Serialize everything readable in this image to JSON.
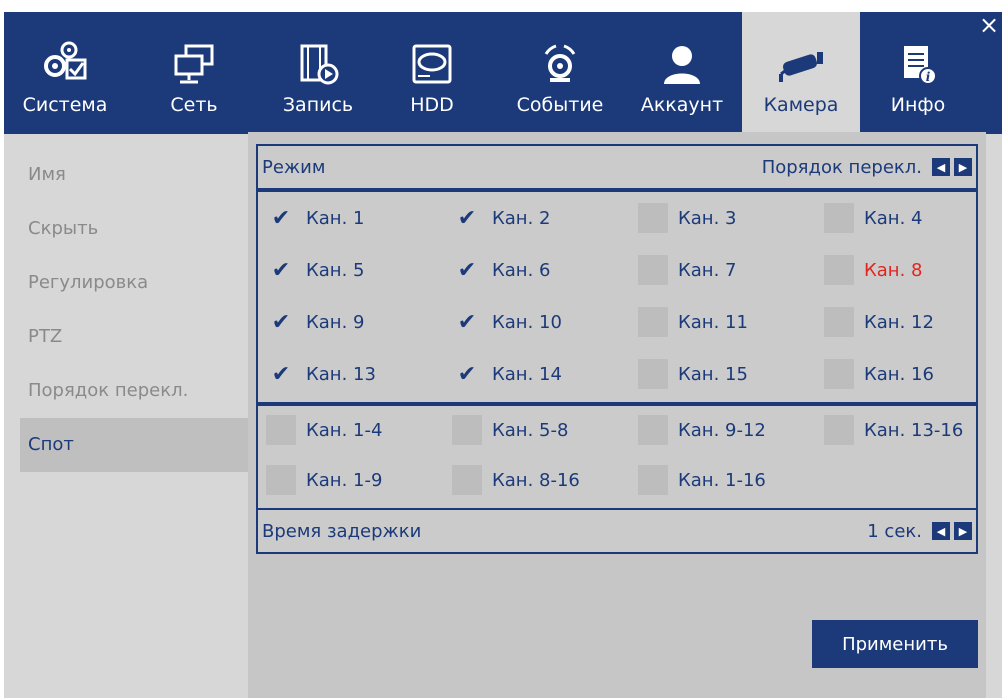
{
  "tabs": [
    {
      "label": "Система",
      "icon": "gears-icon",
      "active": false
    },
    {
      "label": "Сеть",
      "icon": "network-icon",
      "active": false
    },
    {
      "label": "Запись",
      "icon": "film-record-icon",
      "active": false
    },
    {
      "label": "HDD",
      "icon": "hdd-icon",
      "active": false
    },
    {
      "label": "Событие",
      "icon": "alarm-icon",
      "active": false
    },
    {
      "label": "Аккаунт",
      "icon": "user-icon",
      "active": false
    },
    {
      "label": "Камера",
      "icon": "camera-icon",
      "active": true
    },
    {
      "label": "Инфо",
      "icon": "info-icon",
      "active": false
    }
  ],
  "sidebar": {
    "items": [
      {
        "label": "Имя",
        "active": false
      },
      {
        "label": "Скрыть",
        "active": false
      },
      {
        "label": "Регулировка",
        "active": false
      },
      {
        "label": "PTZ",
        "active": false
      },
      {
        "label": "Порядок перекл.",
        "active": false
      },
      {
        "label": "Спот",
        "active": true
      }
    ]
  },
  "mode": {
    "label": "Режим",
    "switch_label": "Порядок перекл."
  },
  "channels": [
    {
      "label": "Кан. 1",
      "checked": true,
      "red": false
    },
    {
      "label": "Кан. 2",
      "checked": true,
      "red": false
    },
    {
      "label": "Кан. 3",
      "checked": false,
      "red": false
    },
    {
      "label": "Кан. 4",
      "checked": false,
      "red": false
    },
    {
      "label": "Кан. 5",
      "checked": true,
      "red": false
    },
    {
      "label": "Кан. 6",
      "checked": true,
      "red": false
    },
    {
      "label": "Кан. 7",
      "checked": false,
      "red": false
    },
    {
      "label": "Кан. 8",
      "checked": false,
      "red": true
    },
    {
      "label": "Кан. 9",
      "checked": true,
      "red": false
    },
    {
      "label": "Кан. 10",
      "checked": true,
      "red": false
    },
    {
      "label": "Кан. 11",
      "checked": false,
      "red": false
    },
    {
      "label": "Кан. 12",
      "checked": false,
      "red": false
    },
    {
      "label": "Кан. 13",
      "checked": true,
      "red": false
    },
    {
      "label": "Кан. 14",
      "checked": true,
      "red": false
    },
    {
      "label": "Кан. 15",
      "checked": false,
      "red": false
    },
    {
      "label": "Кан. 16",
      "checked": false,
      "red": false
    }
  ],
  "groups": [
    {
      "label": "Кан. 1-4",
      "checked": false
    },
    {
      "label": "Кан. 5-8",
      "checked": false
    },
    {
      "label": "Кан. 9-12",
      "checked": false
    },
    {
      "label": "Кан. 13-16",
      "checked": false
    },
    {
      "label": "Кан. 1-9",
      "checked": false
    },
    {
      "label": "Кан. 8-16",
      "checked": false
    },
    {
      "label": "Кан. 1-16",
      "checked": false
    }
  ],
  "delay": {
    "label": "Время задержки",
    "value": "1 сек."
  },
  "apply_label": "Применить",
  "close_label": "×",
  "colors": {
    "accent": "#1c3a7a",
    "background": "#d7d7d7",
    "warning": "#e0261e"
  }
}
